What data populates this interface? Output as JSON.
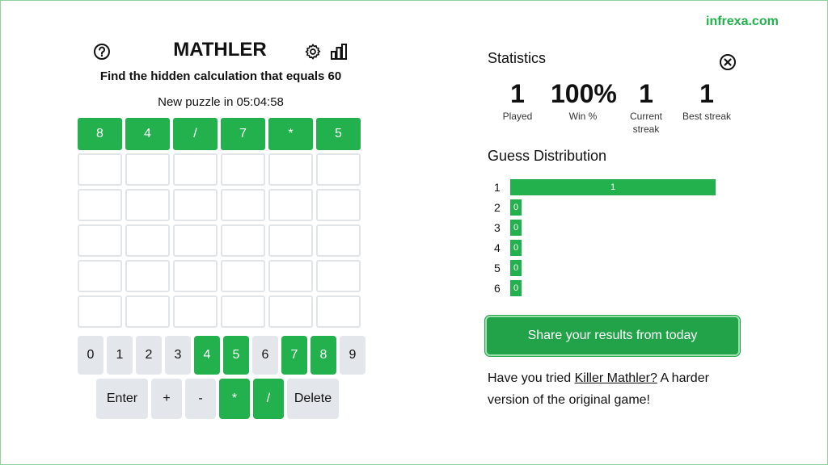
{
  "brand": "infrexa.com",
  "game": {
    "title": "MATHLER",
    "subtitle": "Find the hidden calculation that equals 60",
    "countdown_label": "New puzzle in",
    "countdown_time": "05:04:58",
    "icons": {
      "help": "help-circle-icon",
      "settings": "gear-icon",
      "stats": "bar-chart-icon"
    },
    "board": [
      [
        "8",
        "4",
        "/",
        "7",
        "*",
        "5"
      ],
      [
        "",
        "",
        "",
        "",
        "",
        ""
      ],
      [
        "",
        "",
        "",
        "",
        "",
        ""
      ],
      [
        "",
        "",
        "",
        "",
        "",
        ""
      ],
      [
        "",
        "",
        "",
        "",
        "",
        ""
      ],
      [
        "",
        "",
        "",
        "",
        "",
        ""
      ]
    ],
    "digit_keys": [
      {
        "label": "0",
        "state": "unused"
      },
      {
        "label": "1",
        "state": "unused"
      },
      {
        "label": "2",
        "state": "unused"
      },
      {
        "label": "3",
        "state": "unused"
      },
      {
        "label": "4",
        "state": "correct"
      },
      {
        "label": "5",
        "state": "correct"
      },
      {
        "label": "6",
        "state": "unused"
      },
      {
        "label": "7",
        "state": "correct"
      },
      {
        "label": "8",
        "state": "correct"
      },
      {
        "label": "9",
        "state": "unused"
      }
    ],
    "op_keys": [
      {
        "label": "Enter",
        "state": "unused"
      },
      {
        "label": "+",
        "state": "unused"
      },
      {
        "label": "-",
        "state": "unused"
      },
      {
        "label": "*",
        "state": "correct"
      },
      {
        "label": "/",
        "state": "correct"
      },
      {
        "label": "Delete",
        "state": "unused"
      }
    ]
  },
  "stats": {
    "title": "Statistics",
    "close_icon": "close-circle-icon",
    "items": [
      {
        "value": "1",
        "label": "Played"
      },
      {
        "value": "100%",
        "label": "Win %"
      },
      {
        "value": "1",
        "label": "Current\nstreak"
      },
      {
        "value": "1",
        "label": "Best streak"
      }
    ],
    "distribution_title": "Guess Distribution",
    "distribution": [
      {
        "guess": "1",
        "count": 1
      },
      {
        "guess": "2",
        "count": 0
      },
      {
        "guess": "3",
        "count": 0
      },
      {
        "guess": "4",
        "count": 0
      },
      {
        "guess": "5",
        "count": 0
      },
      {
        "guess": "6",
        "count": 0
      }
    ],
    "share_label": "Share your results from today",
    "promo_prefix": "Have you tried ",
    "promo_link": "Killer Mathler?",
    "promo_suffix": " A harder version of the original game!"
  },
  "colors": {
    "accent": "#22b14c",
    "key_bg": "#e3e6ea",
    "tile_border": "#e2e5e8"
  }
}
